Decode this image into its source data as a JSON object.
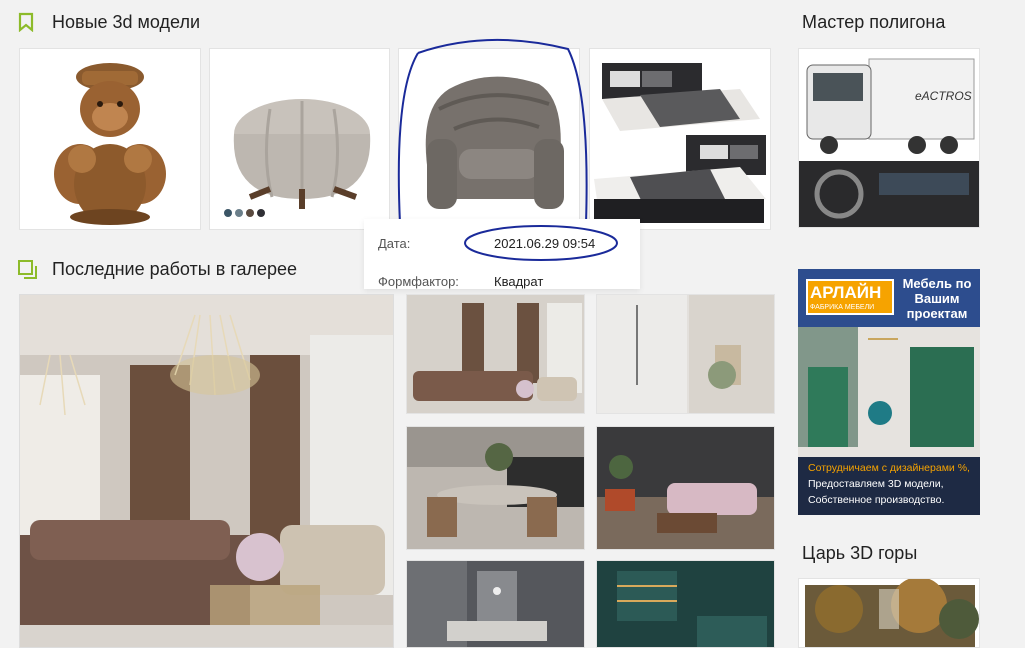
{
  "sections": {
    "new_models": {
      "title": "Новые 3d модели"
    },
    "master": {
      "title": "Мастер полигона"
    },
    "gallery": {
      "title": "Последние работы в галерее"
    },
    "king": {
      "title": "Царь 3D горы"
    }
  },
  "models": [
    {
      "name": "monkey-figurine"
    },
    {
      "name": "pumpkin-pouf",
      "swatches": [
        "#3b5566",
        "#6b7f8a",
        "#5a4a3f",
        "#2f2f35"
      ]
    },
    {
      "name": "velvet-armchair"
    },
    {
      "name": "double-bed"
    }
  ],
  "popup": {
    "date_label": "Дата:",
    "date_value": "2021.06.29 09:54",
    "format_label": "Формфактор:",
    "format_value": "Квадрат"
  },
  "master_truck": {
    "brand": "eACTROS"
  },
  "ad": {
    "logo": "АРЛАЙН",
    "logo_sub": "ФАБРИКА МЕБЕЛИ",
    "headline": "Мебель по Вашим проектам",
    "line1": "Сотрудничаем с дизайнерами %,",
    "line2": "Предоставляем 3D модели,",
    "line3": "Собственное производство."
  },
  "colors": {
    "accent": "#8dbb2a",
    "ad_blue": "#2d4d8e",
    "ad_orange": "#f6a300",
    "annotation": "#1a2a9a"
  }
}
